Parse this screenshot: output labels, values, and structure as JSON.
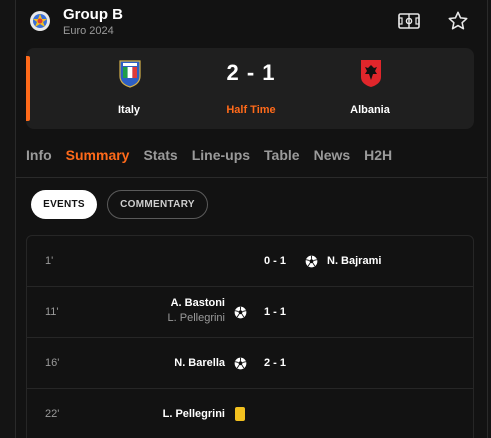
{
  "header": {
    "title": "Group B",
    "subtitle": "Euro 2024",
    "league_logo_icon": "euro-2024-logo",
    "pitch_icon": "pitch-icon",
    "favorite_icon": "star-icon"
  },
  "match": {
    "home_team": "Italy",
    "away_team": "Albania",
    "score": "2 - 1",
    "status": "Half Time",
    "status_color": "#ff6a1a"
  },
  "tabs": [
    {
      "label": "Info",
      "active": false
    },
    {
      "label": "Summary",
      "active": true
    },
    {
      "label": "Stats",
      "active": false
    },
    {
      "label": "Line-ups",
      "active": false
    },
    {
      "label": "Table",
      "active": false
    },
    {
      "label": "News",
      "active": false
    },
    {
      "label": "H2H",
      "active": false
    }
  ],
  "filters": {
    "events_label": "EVENTS",
    "commentary_label": "COMMENTARY",
    "selected": "EVENTS"
  },
  "events": [
    {
      "minute": "1'",
      "side": "away",
      "type": "goal",
      "player": "N. Bajrami",
      "assist": "",
      "score": "0 - 1"
    },
    {
      "minute": "11'",
      "side": "home",
      "type": "goal",
      "player": "A. Bastoni",
      "assist": "L. Pellegrini",
      "score": "1 - 1"
    },
    {
      "minute": "16'",
      "side": "home",
      "type": "goal",
      "player": "N. Barella",
      "assist": "",
      "score": "2 - 1"
    },
    {
      "minute": "22'",
      "side": "home",
      "type": "yellow-card",
      "player": "L. Pellegrini",
      "assist": "",
      "score": ""
    }
  ],
  "colors": {
    "accent": "#ff6a1a",
    "background": "#121212",
    "card": "#1f1f1f",
    "yellow_card": "#f2c01f"
  }
}
